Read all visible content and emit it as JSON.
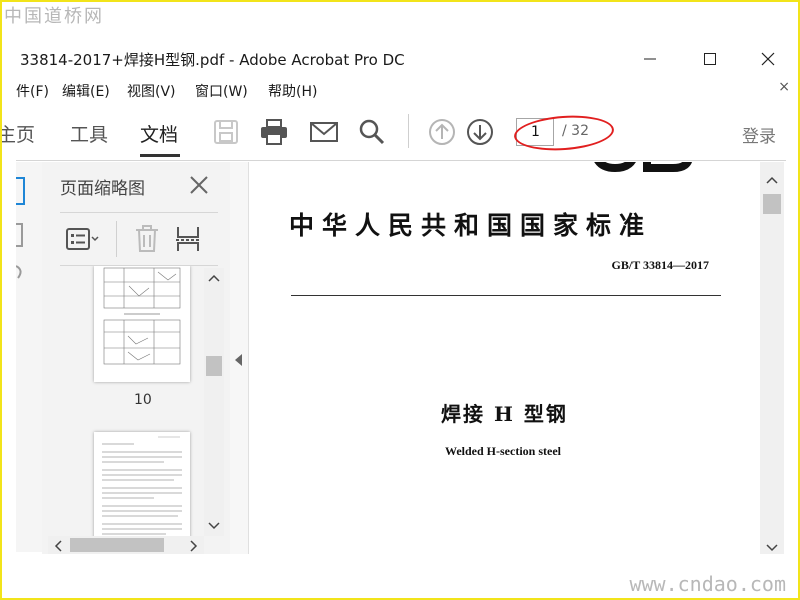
{
  "watermarks": {
    "top": "中国道桥网",
    "bottom": "www.cndao.com"
  },
  "window": {
    "title": "33814-2017+焊接H型钢.pdf - Adobe Acrobat Pro DC"
  },
  "menu": {
    "items": [
      "件(F)",
      "编辑(E)",
      "视图(V)",
      "窗口(W)",
      "帮助(H)"
    ],
    "close_symbol": "×"
  },
  "toolbar": {
    "tabs": [
      "主页",
      "工具",
      "文档"
    ],
    "page_current": "1",
    "page_total": "/ 32",
    "login": "登录"
  },
  "panel": {
    "title": "页面缩略图",
    "thumb_label": "10"
  },
  "document": {
    "heading": "中华人民共和国国家标准",
    "code": "GB/T 33814—2017",
    "title_cn": "焊接 H 型钢",
    "title_en": "Welded H-section steel"
  },
  "colors": {
    "frame": "#f2e41a",
    "annotation": "#e11f1f",
    "accent": "#1e86d6"
  },
  "icons": [
    "minimize-icon",
    "maximize-icon",
    "close-icon",
    "save-icon",
    "print-icon",
    "mail-icon",
    "search-icon",
    "arrow-up-icon",
    "arrow-down-icon",
    "options-icon",
    "trash-icon",
    "extract-icon"
  ]
}
